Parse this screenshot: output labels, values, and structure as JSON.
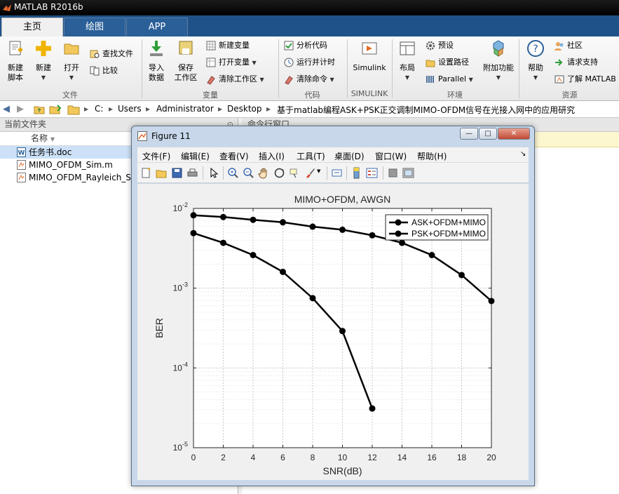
{
  "app": {
    "title": "MATLAB R2016b"
  },
  "tabs": [
    {
      "label": "主页"
    },
    {
      "label": "绘图"
    },
    {
      "label": "APP"
    }
  ],
  "ribbon": {
    "new_script": "新建\n脚本",
    "new_script_l1": "新建",
    "new_script_l2": "脚本",
    "new": "新建",
    "open": "打开",
    "find_files": "查找文件",
    "compare": "比较",
    "import_l1": "导入",
    "import_l2": "数据",
    "save_ws_l1": "保存",
    "save_ws_l2": "工作区",
    "new_var": "新建变量",
    "open_var": "打开变量",
    "clear_ws": "清除工作区",
    "analyze_code": "分析代码",
    "run_time": "运行并计时",
    "clear_cmd": "清除命令",
    "simulink": "Simulink",
    "layout": "布局",
    "preferences": "预设",
    "set_path": "设置路径",
    "parallel": "Parallel",
    "addons": "附加功能",
    "help": "帮助",
    "community": "社区",
    "request_support": "请求支持",
    "learn_matlab": "了解 MATLAB",
    "groups": {
      "file": "文件",
      "variable": "变量",
      "code": "代码",
      "simulink": "SIMULINK",
      "environment": "环境",
      "resources": "资源"
    }
  },
  "address": {
    "crumbs": [
      "C:",
      "Users",
      "Administrator",
      "Desktop",
      "基于matlab编程ASK+PSK正交调制MIMO-OFDM信号在光接入网中的应用研究"
    ]
  },
  "current_folder": {
    "title": "当前文件夹",
    "column_name": "名称",
    "files": [
      {
        "name": "任务书.doc",
        "selected": true
      },
      {
        "name": "MIMO_OFDM_Sim.m",
        "selected": false
      },
      {
        "name": "MIMO_OFDM_Rayleich_Si",
        "selected": false
      }
    ]
  },
  "command_window": {
    "title": "命令行窗口"
  },
  "figure": {
    "window_title": "Figure 11",
    "menu": [
      "文件(F)",
      "编辑(E)",
      "查看(V)",
      "插入(I)",
      "工具(T)",
      "桌面(D)",
      "窗口(W)",
      "帮助(H)"
    ]
  },
  "colors": {
    "tab_bar": "#1f5289",
    "title_bar": "#000000",
    "selection": "#cce1f7"
  },
  "chart_data": {
    "type": "line",
    "title": "MIMO+OFDM, AWGN",
    "xlabel": "SNR(dB)",
    "ylabel": "BER",
    "xlim": [
      0,
      20
    ],
    "ylim": [
      1e-05,
      0.01
    ],
    "yscale": "log",
    "grid": true,
    "legend_position": "top-right",
    "x_ticks": [
      "0",
      "2",
      "4",
      "6",
      "8",
      "10",
      "12",
      "14",
      "16",
      "18",
      "20"
    ],
    "y_tick_labels": [
      {
        "base": "10",
        "exp": "-2"
      },
      {
        "base": "10",
        "exp": "-3"
      },
      {
        "base": "10",
        "exp": "-4"
      },
      {
        "base": "10",
        "exp": "-5"
      }
    ],
    "series": [
      {
        "name": "ASK+OFDM+MIMO",
        "x": [
          0,
          2,
          4,
          6,
          8,
          10,
          12,
          14,
          16,
          18,
          20
        ],
        "y": [
          0.0082,
          0.0078,
          0.0072,
          0.0067,
          0.0059,
          0.0054,
          0.0046,
          0.0037,
          0.0026,
          0.00146,
          0.00069
        ]
      },
      {
        "name": "PSK+OFDM+MIMO",
        "x": [
          0,
          2,
          4,
          6,
          8,
          10,
          12
        ],
        "y": [
          0.0049,
          0.0037,
          0.0026,
          0.0016,
          0.00075,
          0.00029,
          3.1e-05
        ]
      }
    ]
  }
}
